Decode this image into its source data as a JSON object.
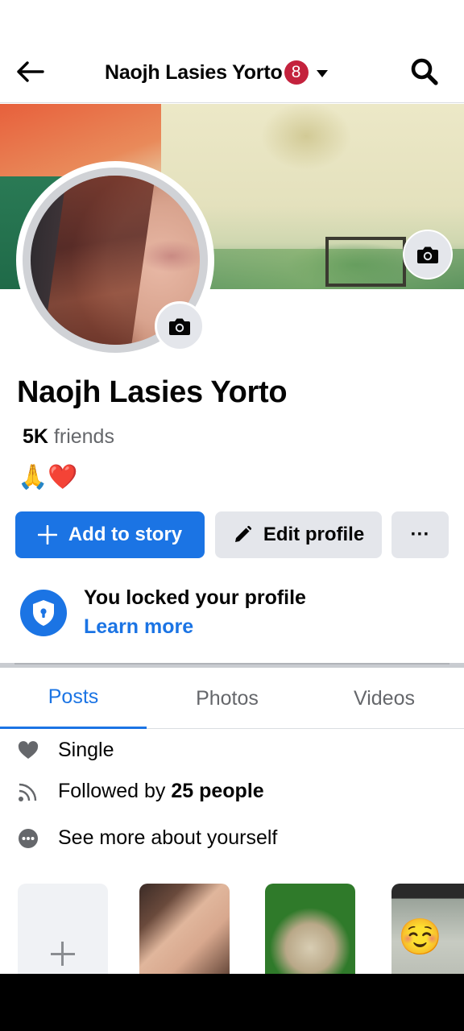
{
  "header": {
    "title": "Naojh Lasies Yorto",
    "notification_count": "8"
  },
  "profile": {
    "name": "Naojh Lasies Yorto",
    "friends_count": "5K",
    "friends_label": "friends",
    "bio_emoji": "🙏❤️"
  },
  "actions": {
    "add_story": "Add to story",
    "edit_profile": "Edit profile",
    "more": "···"
  },
  "lock_notice": {
    "title": "You locked your profile",
    "link": "Learn more"
  },
  "tabs": [
    {
      "label": "Posts",
      "active": true
    },
    {
      "label": "Photos",
      "active": false
    },
    {
      "label": "Videos",
      "active": false
    }
  ],
  "details": {
    "relationship": "Single",
    "followed_prefix": "Followed by",
    "followed_count": "25 people",
    "see_more": "See more about yourself"
  },
  "stories": {
    "thumb_3_emoji": "☺️"
  },
  "colors": {
    "accent": "#1b74e4",
    "badge": "#c4223d",
    "secondary_button": "#e4e6eb",
    "muted_text": "#65676b"
  }
}
